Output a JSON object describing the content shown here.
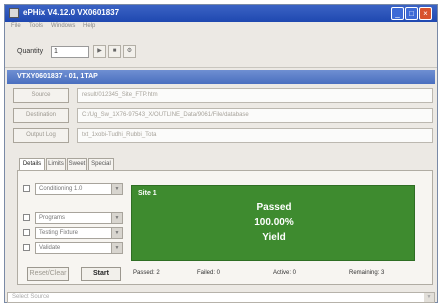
{
  "window": {
    "title": "ePHix V4.12.0 VX0601837"
  },
  "menu": [
    "File",
    "Tools",
    "Windows",
    "Help"
  ],
  "toolbar": {
    "quantity_label": "Quantity",
    "quantity_value": "1"
  },
  "panel": {
    "title": "VTXY0601837 - 01, 1TAP"
  },
  "rows": [
    {
      "button": "Source",
      "value": "result/012345_Site_FTP.htm"
    },
    {
      "button": "Destination",
      "value": "C:/Ug_Sw_1X76-97543_X/OUTLINE_Data/9061/File/database"
    },
    {
      "button": "Output Log",
      "value": "txt_1xobi-Tudhi_Rubbi_Tota"
    }
  ],
  "tabs": [
    "Details",
    "Limits",
    "Sweet",
    "Special"
  ],
  "controls": {
    "combo1": "Conditioning 1.0",
    "combo2": "Programs",
    "combo3": "Testing Fixture",
    "combo4": "Validate",
    "reset_button": "Reset/Clear",
    "start_button": "Start"
  },
  "result": {
    "site": "Site 1",
    "status": "Passed",
    "percent": "100.00%",
    "label": "Yield"
  },
  "stats": {
    "passed": "Passed: 2",
    "failed": "Failed: 0",
    "active": "Active: 0",
    "remaining": "Remaining: 3"
  },
  "statusbar": {
    "text": "Select Source"
  }
}
